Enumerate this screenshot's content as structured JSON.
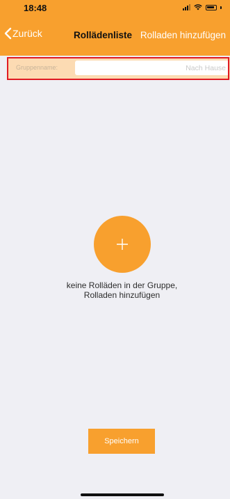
{
  "status_bar": {
    "time": "18:48"
  },
  "nav": {
    "back_label": "Zurück",
    "title": "Rollädenliste",
    "action_label": "Rolladen hinzufügen"
  },
  "group": {
    "label": "Gruppenname:",
    "value": "Nach Hause"
  },
  "empty_state": {
    "line1": "keine Rolläden in der Gruppe,",
    "line2": "Rolladen hinzufügen"
  },
  "save_label": "Speichern",
  "colors": {
    "accent": "#f8a02e",
    "background": "#efeff4",
    "group_row": "#fcdbb3",
    "highlight": "#e01a22"
  }
}
